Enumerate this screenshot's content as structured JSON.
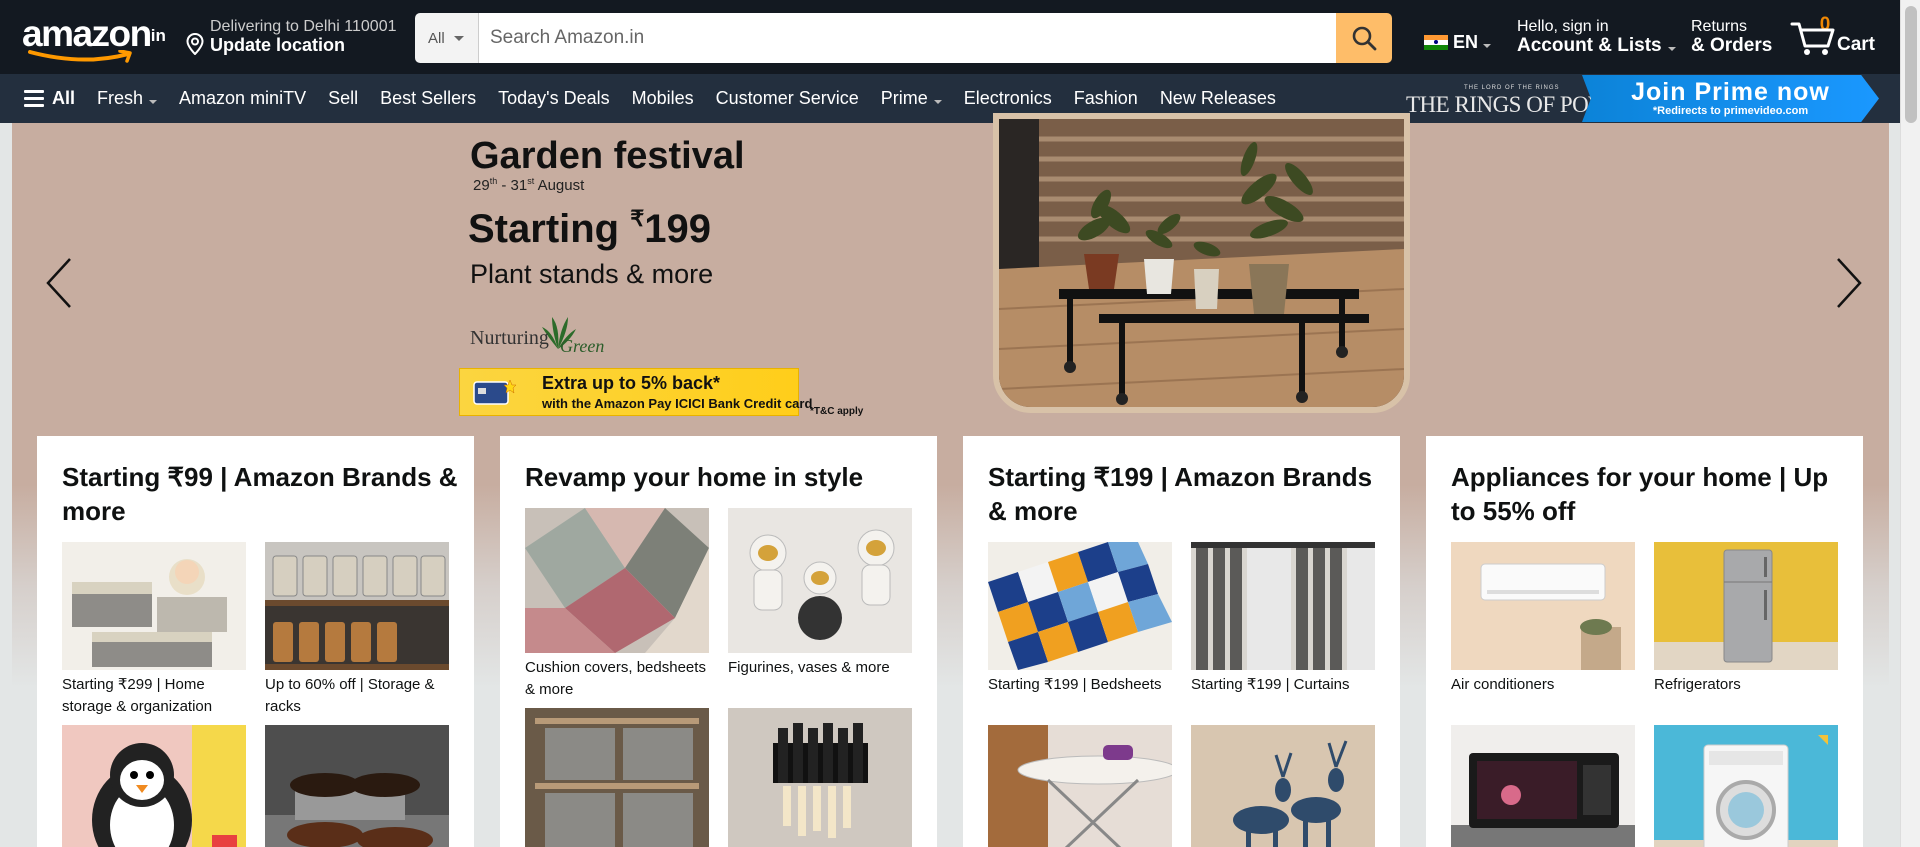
{
  "header": {
    "logo_text": "amazon",
    "logo_tld": ".in",
    "deliver_line1": "Delivering to Delhi 110001",
    "deliver_line2": "Update location",
    "search_category": "All",
    "search_placeholder": "Search Amazon.in",
    "language": "EN",
    "account_line1": "Hello, sign in",
    "account_line2": "Account & Lists",
    "orders_line1": "Returns",
    "orders_line2": "& Orders",
    "cart_count": "0",
    "cart_label": "Cart"
  },
  "nav": {
    "all_label": "All",
    "links": [
      {
        "label": "Fresh",
        "dropdown": true
      },
      {
        "label": "Amazon miniTV",
        "dropdown": false
      },
      {
        "label": "Sell",
        "dropdown": false
      },
      {
        "label": "Best Sellers",
        "dropdown": false
      },
      {
        "label": "Today's Deals",
        "dropdown": false
      },
      {
        "label": "Mobiles",
        "dropdown": false
      },
      {
        "label": "Customer Service",
        "dropdown": false
      },
      {
        "label": "Prime",
        "dropdown": true
      },
      {
        "label": "Electronics",
        "dropdown": false
      },
      {
        "label": "Fashion",
        "dropdown": false
      },
      {
        "label": "New Releases",
        "dropdown": false
      }
    ],
    "promo_small": "THE LORD OF THE RINGS",
    "promo_title": "THE RINGS OF POWER",
    "promo_button": "Join Prime now",
    "promo_redirect": "*Redirects to primevideo.com"
  },
  "hero": {
    "title": "Garden festival",
    "dates_a": "29",
    "dates_a_sup": "th",
    "dates_b": " - 31",
    "dates_b_sup": "st",
    "dates_c": " August",
    "starting": "Starting ",
    "currency": "₹",
    "price": "199",
    "subtitle": "Plant stands & more",
    "brand_a": "Nurturing",
    "brand_b": "Green",
    "offer_line1": "Extra up to 5% back*",
    "offer_line2": "with the Amazon Pay ICICI Bank Credit card",
    "tnc": "*T&C apply"
  },
  "cards": [
    {
      "title": "Starting ₹99 | Amazon Brands & more",
      "tiles": [
        {
          "caption": "Starting ₹299 | Home storage & organization"
        },
        {
          "caption": "Up to 60% off | Storage & racks"
        },
        {
          "caption": ""
        },
        {
          "caption": ""
        }
      ]
    },
    {
      "title": "Revamp your home in style",
      "tiles": [
        {
          "caption": "Cushion covers, bedsheets & more"
        },
        {
          "caption": "Figurines, vases & more"
        },
        {
          "caption": ""
        },
        {
          "caption": ""
        }
      ]
    },
    {
      "title": "Starting ₹199 | Amazon Brands & more",
      "tiles": [
        {
          "caption": "Starting ₹199 | Bedsheets"
        },
        {
          "caption": "Starting ₹199 | Curtains"
        },
        {
          "caption": ""
        },
        {
          "caption": ""
        }
      ]
    },
    {
      "title": "Appliances for your home | Up to 55% off",
      "tiles": [
        {
          "caption": "Air conditioners"
        },
        {
          "caption": "Refrigerators"
        },
        {
          "caption": ""
        },
        {
          "caption": ""
        }
      ]
    }
  ],
  "colors": {
    "header_bg": "#131921",
    "subnav_bg": "#232f3e",
    "search_button": "#febd69",
    "cart_count": "#f08804",
    "prime_blue": "#1a98ff",
    "hero_bg": "#c7ada0"
  },
  "icons": [
    "location-pin-icon",
    "search-icon",
    "cart-icon",
    "hamburger-icon",
    "chevron-left-icon",
    "chevron-right-icon",
    "india-flag-icon"
  ]
}
